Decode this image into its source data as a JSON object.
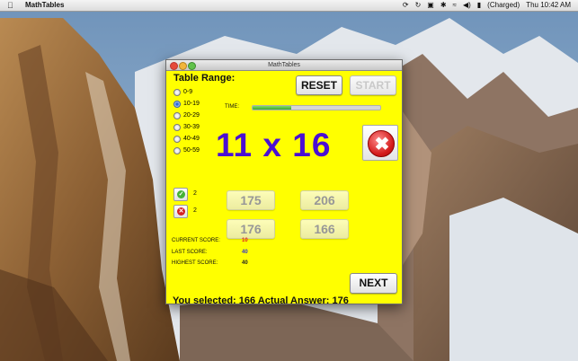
{
  "menubar": {
    "app_name": "MathTables",
    "battery_text": "(Charged)",
    "clock": "Thu 10:42 AM"
  },
  "window": {
    "title": "MathTables",
    "table_range_label": "Table Range:",
    "ranges": [
      {
        "label": "0-9",
        "selected": false
      },
      {
        "label": "10-19",
        "selected": true
      },
      {
        "label": "20-29",
        "selected": false
      },
      {
        "label": "30-39",
        "selected": false
      },
      {
        "label": "40-49",
        "selected": false
      },
      {
        "label": "50-59",
        "selected": false
      }
    ],
    "reset_label": "RESET",
    "start_label": "START",
    "time_label": "TIME:",
    "time_progress": 0.3,
    "question": "11 x 16",
    "correct_count": "2",
    "wrong_count": "2",
    "answers": [
      "175",
      "206",
      "176",
      "166"
    ],
    "current_score_label": "CURRENT SCORE:",
    "current_score": "10",
    "last_score_label": "LAST SCORE:",
    "last_score": "40",
    "highest_score_label": "HIGHEST SCORE:",
    "highest_score": "40",
    "next_label": "NEXT",
    "result_text": "You selected: 166  Actual Answer: 176"
  },
  "colors": {
    "window_bg": "#ffff00",
    "question": "#4b0fd3",
    "current_score": "#e02020",
    "last_score": "#3333cc",
    "highest_score": "#222222",
    "time_fill": "#4fbb3a"
  }
}
